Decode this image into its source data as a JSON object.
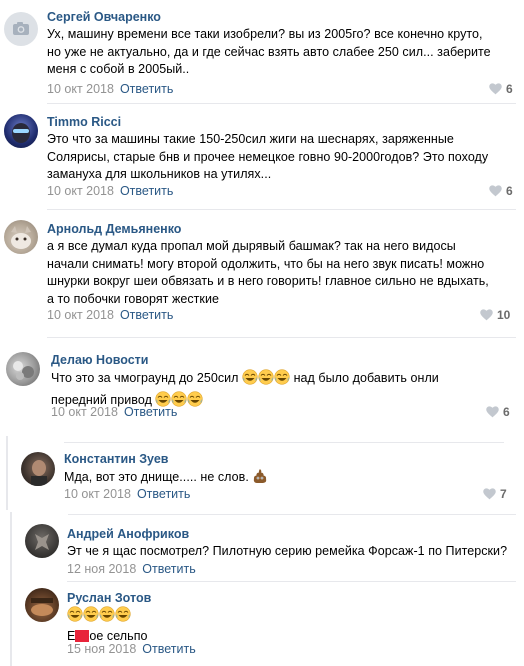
{
  "comments": [
    {
      "author": "Сергей Овчаренко",
      "avatar_icon": "camera-icon",
      "lines": [
        "Ух, машину времени все таки изобрели? вы из 2005го? все конечно круто,",
        "но уже не актуально, да и где сейчас взять авто слабее 250 сил... заберите",
        "меня с собой в 2005ый.."
      ],
      "date": "10 окт 2018",
      "reply": "Ответить",
      "likes": "6"
    },
    {
      "author": "Timmo Ricci",
      "avatar_icon": "avatar-photo",
      "lines": [
        "Это что за машины такие 150-250сил жиги на шеснарях, заряженные",
        "Солярисы, старые бнв и прочее немецкое говно 90-2000годов? Это походу",
        "замануха для школьников на утилях..."
      ],
      "date": "10 окт 2018",
      "reply": "Ответить",
      "likes": "6"
    },
    {
      "author": "Арнольд Демьяненко",
      "avatar_icon": "avatar-photo",
      "lines": [
        "а я все думал куда пропал мой дырявый башмак? так на него видосы",
        "начали снимать! могу второй одолжить, что бы на него звук писать! можно",
        "шнурки вокруг шеи обвязать и в него говорить! главное сильно не вдыхать,",
        "а то побочки говорят жесткие"
      ],
      "date": "10 окт 2018",
      "reply": "Ответить",
      "likes": "10"
    },
    {
      "author": "Делаю Новости",
      "avatar_icon": "avatar-photo",
      "line1_before": "Что это за чмограунд до 250сил ",
      "line1_after": " над было добавить онли",
      "line2_before": "передний привод ",
      "emoji_icon": "laughing-emoji",
      "date": "10 окт 2018",
      "reply": "Ответить",
      "likes": "6"
    }
  ],
  "replies": [
    {
      "author": "Константин Зуев",
      "text": "Мда, вот это днище..... не слов. ",
      "emoji_icon": "poop-emoji",
      "date": "10 окт 2018",
      "reply": "Ответить",
      "likes": "7"
    },
    {
      "author": "Андрей Анофриков",
      "text": "Эт че я щас посмотрел? Пилотную серию ремейка Форсаж-1 по Питерски?",
      "date": "12 ноя 2018",
      "reply": "Ответить"
    },
    {
      "author": "Руслан Зотов",
      "emoji_icon": "laughing-emoji",
      "text_before": "Е",
      "text_after": "ое сельпо",
      "date": "15 ноя 2018",
      "reply": "Ответить"
    }
  ],
  "colors": {
    "link": "#2a5885",
    "meta": "#939393",
    "separator": "#e7e8ec",
    "redaction": "#e8233a"
  }
}
